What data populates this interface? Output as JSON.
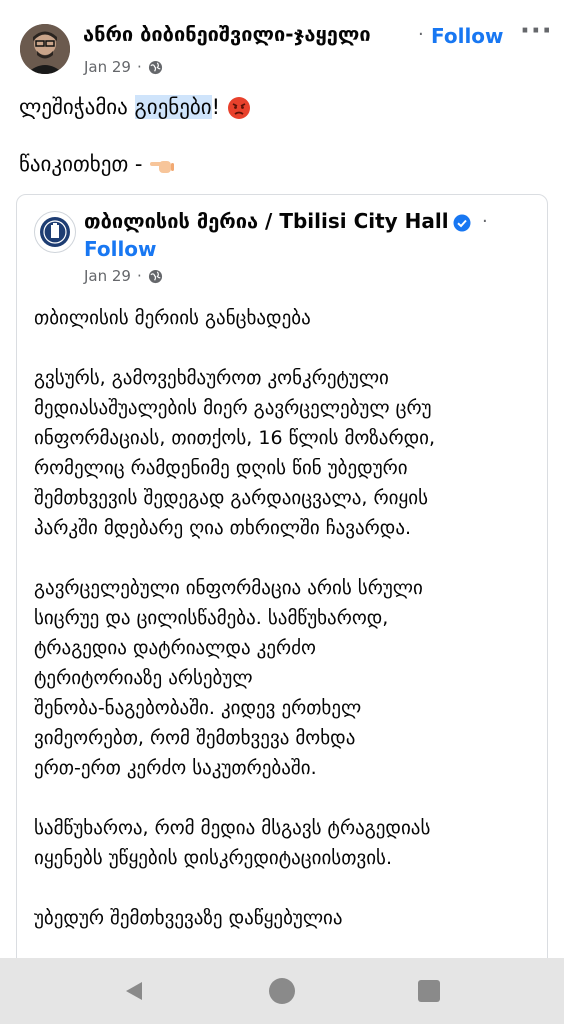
{
  "post": {
    "author": "ანრი ბიბინეიშვილი-ჯაყელი",
    "follow_label": "Follow",
    "date": "Jan 29",
    "text_before": "ლეშიჭამია ",
    "text_highlight": "გიენები",
    "text_after": "! ",
    "text_line2": "წაიკითხეთ -",
    "icons": [
      "avatar-photo",
      "globe-icon",
      "more-options-icon",
      "angry-face-emoji",
      "pointing-hand-emoji"
    ]
  },
  "shared": {
    "author": "თბილისის მერია / Tbilisi City Hall",
    "follow_label": "Follow",
    "date": "Jan 29",
    "paragraphs": [
      [
        "თბილისის მერიის განცხადება"
      ],
      [
        "გვსურს, გამოვეხმაუროთ კონკრეტული",
        "მედიასაშუალების მიერ გავრცელებულ ცრუ",
        "ინფორმაციას, თითქოს, 16 წლის მოზარდი,",
        "რომელიც რამდენიმე დღის წინ უბედური",
        "შემთხვევის შედეგად გარდაიცვალა, რიყის",
        "პარკში მდებარე ღია თხრილში ჩავარდა."
      ],
      [
        "გავრცელებული ინფორმაცია არის სრული",
        "სიცრუე და ცილისწამება. სამწუხაროდ,",
        "ტრაგედია დატრიალდა კერძო",
        "ტერიტორიაზე არსებულ",
        "შენობა-ნაგებობაში.  კიდევ ერთხელ",
        "ვიმეორებთ, რომ შემთხვევა მოხდა",
        "ერთ-ერთ კერძო საკუთრებაში."
      ],
      [
        "სამწუხაროა, რომ მედია მსგავს ტრაგედიას",
        "იყენებს უწყების დისკრედიტაციისთვის."
      ],
      [
        "უბედურ შემთხვევაზე დაწყებულია"
      ]
    ],
    "icons": [
      "city-hall-logo",
      "verified-badge-icon",
      "globe-icon"
    ]
  },
  "nav": {
    "icons": [
      "back-icon",
      "home-icon",
      "recent-apps-icon"
    ]
  },
  "colors": {
    "link_blue": "#1877f2",
    "meta_gray": "#65676b",
    "highlight": "#cfe4fb",
    "nav_bg": "#e5e5e5"
  }
}
